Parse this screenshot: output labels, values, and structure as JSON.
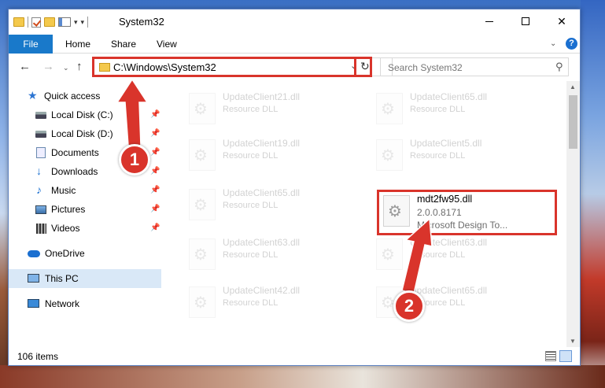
{
  "window": {
    "title": "System32"
  },
  "ribbon": {
    "tabs": [
      "File",
      "Home",
      "Share",
      "View"
    ]
  },
  "address": {
    "path": "C:\\Windows\\System32"
  },
  "search": {
    "placeholder": "Search System32"
  },
  "sidebar": {
    "items": [
      {
        "label": "Quick access",
        "icon": "star-icon"
      },
      {
        "label": "Local Disk (C:)",
        "icon": "disk-icon",
        "pinned": true
      },
      {
        "label": "Local Disk (D:)",
        "icon": "disk-icon",
        "pinned": true
      },
      {
        "label": "Documents",
        "icon": "documents-icon",
        "pinned": true
      },
      {
        "label": "Downloads",
        "icon": "downloads-icon",
        "pinned": true
      },
      {
        "label": "Music",
        "icon": "music-icon",
        "pinned": true
      },
      {
        "label": "Pictures",
        "icon": "pictures-icon",
        "pinned": true
      },
      {
        "label": "Videos",
        "icon": "videos-icon",
        "pinned": true
      },
      {
        "label": "OneDrive",
        "icon": "onedrive-icon"
      },
      {
        "label": "This PC",
        "icon": "pc-icon",
        "selected": true
      },
      {
        "label": "Network",
        "icon": "network-icon"
      }
    ]
  },
  "files": [
    {
      "name": "UpdateClient21.dll",
      "desc": "Resource DLL"
    },
    {
      "name": "UpdateClient65.dll",
      "desc": "Resource DLL"
    },
    {
      "name": "UpdateClient19.dll",
      "desc": "Resource DLL"
    },
    {
      "name": "UpdateClient5.dll",
      "desc": "Resource DLL"
    },
    {
      "name": "UpdateClient65.dll",
      "desc": "Resource DLL"
    },
    {
      "name": "UpdateClient63.dll",
      "desc": "Resource DLL"
    },
    {
      "name": "UpdateClient63.dll",
      "desc": "Resource DLL"
    },
    {
      "name": "UpdateClient42.dll",
      "desc": "Resource DLL"
    },
    {
      "name": "UpdateClient65.dll",
      "desc": "Resource DLL"
    }
  ],
  "highlighted_file": {
    "name": "mdt2fw95.dll",
    "version": "2.0.0.8171",
    "company": "Microsoft Design To..."
  },
  "status": {
    "item_count": "106 items"
  },
  "annotations": {
    "step1": "1",
    "step2": "2"
  },
  "colors": {
    "highlight": "#d9342b",
    "accent": "#1979ca"
  }
}
